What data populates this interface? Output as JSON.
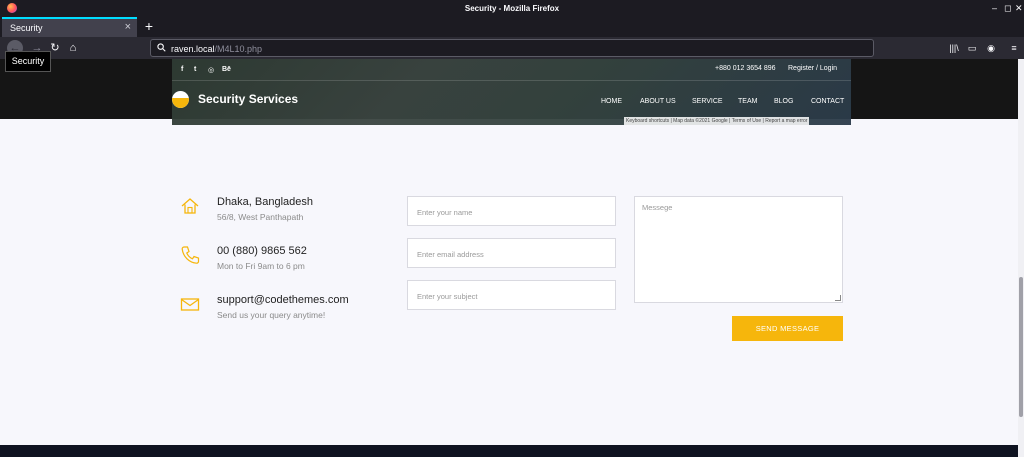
{
  "window": {
    "title": "Security - Mozilla Firefox"
  },
  "tab": {
    "label": "Security",
    "close": "×"
  },
  "new_tab": "+",
  "toolbar": {
    "url_host": "raven.local",
    "url_path": "/M4L10.php",
    "tooltip": "Security"
  },
  "site": {
    "social": [
      "f",
      "t",
      "◎",
      "Bē"
    ],
    "phone": "+880 012 3654 896",
    "auth": "Register / Login",
    "brand": "Security Services",
    "menu": [
      "HOME",
      "ABOUT US",
      "SERVICE",
      "TEAM",
      "BLOG",
      "CONTACT"
    ],
    "map_footer": "Keyboard shortcuts | Map data ©2021 Google | Terms of Use | Report a map error"
  },
  "contact": {
    "address_title": "Dhaka, Bangladesh",
    "address_sub": "56/8, West Panthapath",
    "phone_title": "00 (880) 9865 562",
    "phone_sub": "Mon to Fri 9am to 6 pm",
    "email_title": "support@codethemes.com",
    "email_sub": "Send us your query anytime!"
  },
  "form": {
    "name_placeholder": "Enter your name",
    "email_placeholder": "Enter email address",
    "subject_placeholder": "Enter your subject",
    "message_placeholder": "Messege",
    "send_label": "SEND MESSAGE"
  },
  "colors": {
    "accent": "#f6b60c",
    "header": "#151515",
    "footer": "#0f1321"
  }
}
